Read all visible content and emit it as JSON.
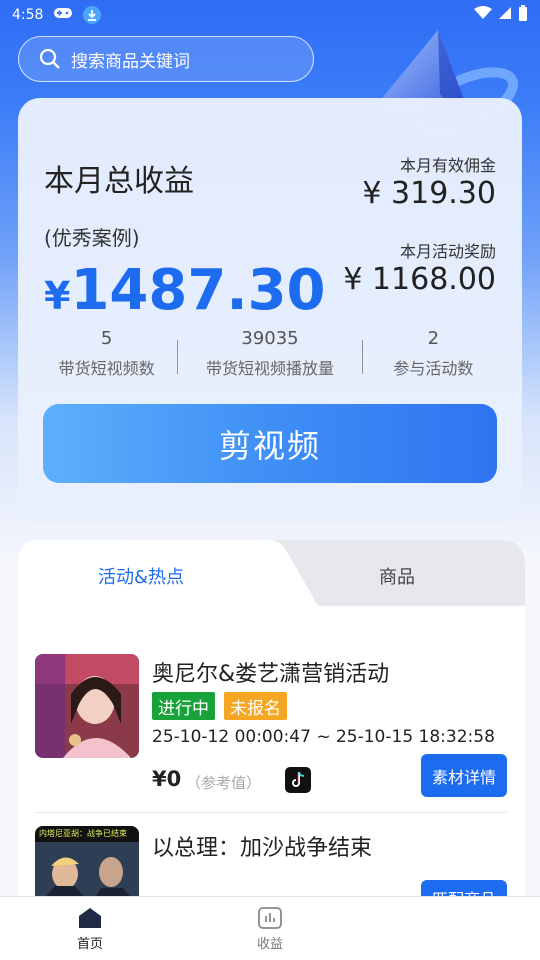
{
  "status_bar": {
    "time": "4:58"
  },
  "search": {
    "placeholder": "搜索商品关键词"
  },
  "earnings": {
    "title": "本月总收益",
    "case_label": "(优秀案例)",
    "total_currency": "¥",
    "total_value": "1487.30",
    "commission_label": "本月有效佣金",
    "commission_value": "¥ 319.30",
    "reward_label": "本月活动奖励",
    "reward_value": "¥ 1168.00",
    "stats": [
      {
        "value": "5",
        "label": "带货短视频数"
      },
      {
        "value": "39035",
        "label": "带货短视频播放量"
      },
      {
        "value": "2",
        "label": "参与活动数"
      }
    ],
    "cut_button": "剪视频"
  },
  "tabs": [
    {
      "label": "活动&热点",
      "active": true
    },
    {
      "label": "商品",
      "active": false
    }
  ],
  "items": [
    {
      "title": "奥尼尔&娄艺潇营销活动",
      "badges": [
        "进行中",
        "未报名"
      ],
      "time_range": "25-10-12 00:00:47 ~ 25-10-15 18:32:58",
      "price": "¥0",
      "price_note": "（参考值）",
      "platform_icon": "tiktok-icon",
      "button": "素材详情"
    },
    {
      "title": "以总理：加沙战争结束",
      "thumb_caption": "内塔尼亚胡：战争已结束",
      "button": "匹配商品"
    }
  ],
  "bottom_nav": [
    {
      "label": "首页",
      "icon": "home-icon",
      "active": true
    },
    {
      "label": "收益",
      "icon": "chart-icon",
      "active": false
    }
  ],
  "colors": {
    "primary": "#1d6cf0",
    "green": "#18a23a",
    "orange": "#f5a623"
  }
}
